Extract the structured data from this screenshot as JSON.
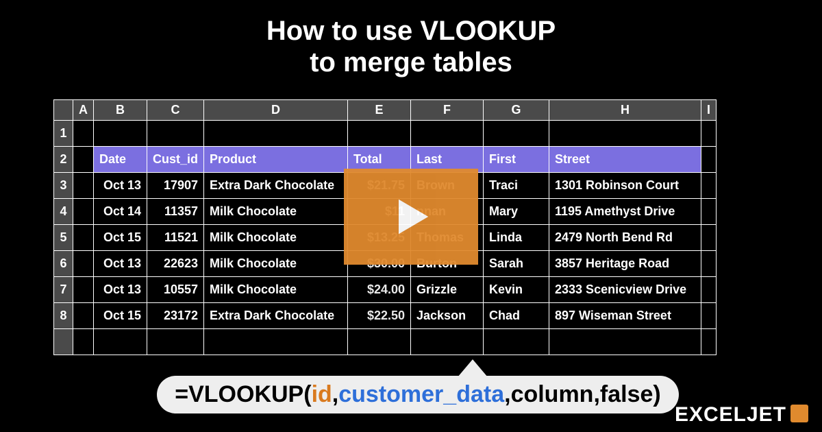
{
  "title_line1": "How to use VLOOKUP",
  "title_line2": "to merge tables",
  "columns": {
    "A": "A",
    "B": "B",
    "C": "C",
    "D": "D",
    "E": "E",
    "F": "F",
    "G": "G",
    "H": "H",
    "I": "I"
  },
  "rownums": {
    "r1": "1",
    "r2": "2",
    "r3": "3",
    "r4": "4",
    "r5": "5",
    "r6": "6",
    "r7": "7",
    "r8": "8"
  },
  "headers": {
    "date": "Date",
    "cust": "Cust_id",
    "product": "Product",
    "total": "Total",
    "last": "Last",
    "first": "First",
    "street": "Street"
  },
  "rows": [
    {
      "date": "Oct 13",
      "cust": "17907",
      "product": "Extra Dark Chocolate",
      "total": "$21.75",
      "last": "Brown",
      "first": "Traci",
      "street": "1301 Robinson Court"
    },
    {
      "date": "Oct 14",
      "cust": "11357",
      "product": "Milk Chocolate",
      "total": "$11",
      "last": "nnan",
      "first": "Mary",
      "street": "1195 Amethyst Drive"
    },
    {
      "date": "Oct 15",
      "cust": "11521",
      "product": "Milk Chocolate",
      "total": "$13.25",
      "last": "Thomas",
      "first": "Linda",
      "street": "2479 North Bend Rd"
    },
    {
      "date": "Oct 13",
      "cust": "22623",
      "product": "Milk Chocolate",
      "total": "$30.00",
      "last": "Burton",
      "first": "Sarah",
      "street": "3857 Heritage Road"
    },
    {
      "date": "Oct 13",
      "cust": "10557",
      "product": "Milk Chocolate",
      "total": "$24.00",
      "last": "Grizzle",
      "first": "Kevin",
      "street": "2333 Scenicview Drive"
    },
    {
      "date": "Oct 15",
      "cust": "23172",
      "product": "Extra Dark Chocolate",
      "total": "$22.50",
      "last": "Jackson",
      "first": "Chad",
      "street": "897 Wiseman Street"
    }
  ],
  "formula": {
    "eq": "=",
    "fn": "VLOOKUP",
    "open": "(",
    "id": "id",
    "c1": ",",
    "table": "customer_data",
    "c2": ",",
    "col": "column",
    "c3": ",",
    "false": "false",
    "close": ")"
  },
  "brand": "EXCELJET"
}
